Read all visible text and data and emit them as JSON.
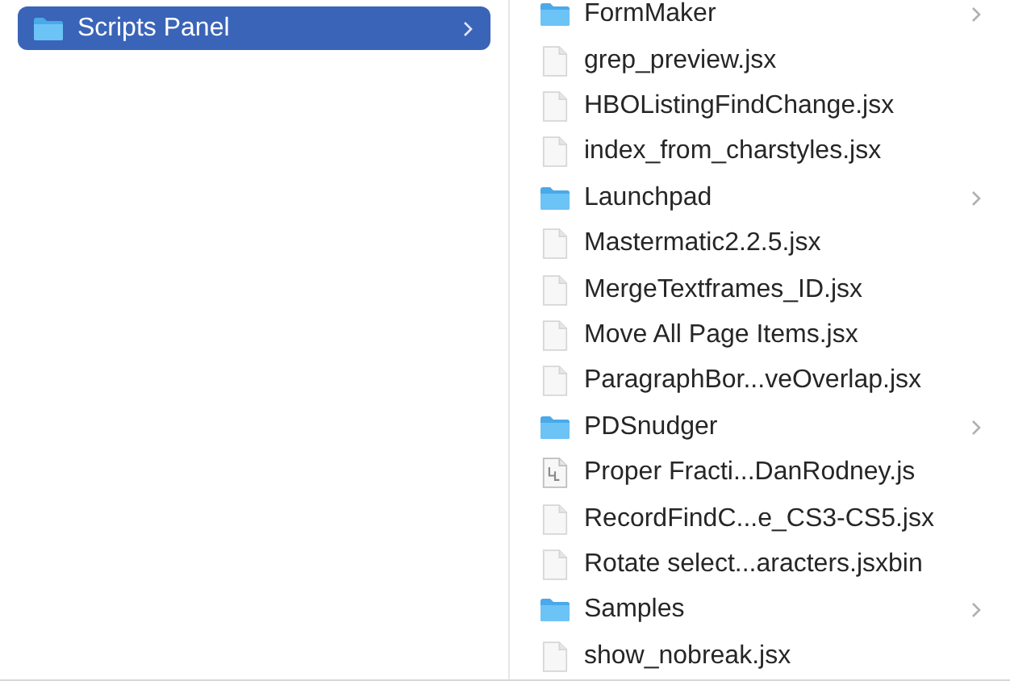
{
  "columns": [
    {
      "items": [
        {
          "label": "Scripts Panel",
          "kind": "folder",
          "selected": true
        }
      ]
    },
    {
      "items": [
        {
          "label": "FormMaker",
          "kind": "folder",
          "selected": false
        },
        {
          "label": "grep_preview.jsx",
          "kind": "file",
          "selected": false
        },
        {
          "label": "HBOListingFindChange.jsx",
          "kind": "file",
          "selected": false
        },
        {
          "label": "index_from_charstyles.jsx",
          "kind": "file",
          "selected": false
        },
        {
          "label": "Launchpad",
          "kind": "folder",
          "selected": false
        },
        {
          "label": "Mastermatic2.2.5.jsx",
          "kind": "file",
          "selected": false
        },
        {
          "label": "MergeTextframes_ID.jsx",
          "kind": "file",
          "selected": false
        },
        {
          "label": "Move All Page Items.jsx",
          "kind": "file",
          "selected": false
        },
        {
          "label": "ParagraphBor...veOverlap.jsx",
          "kind": "file",
          "selected": false
        },
        {
          "label": "PDSnudger",
          "kind": "folder",
          "selected": false
        },
        {
          "label": "Proper Fracti...DanRodney.js",
          "kind": "script",
          "selected": false
        },
        {
          "label": "RecordFindC...e_CS3-CS5.jsx",
          "kind": "file",
          "selected": false
        },
        {
          "label": "Rotate select...aracters.jsxbin",
          "kind": "file",
          "selected": false
        },
        {
          "label": "Samples",
          "kind": "folder",
          "selected": false
        },
        {
          "label": "show_nobreak.jsx",
          "kind": "file",
          "selected": false
        }
      ]
    }
  ]
}
